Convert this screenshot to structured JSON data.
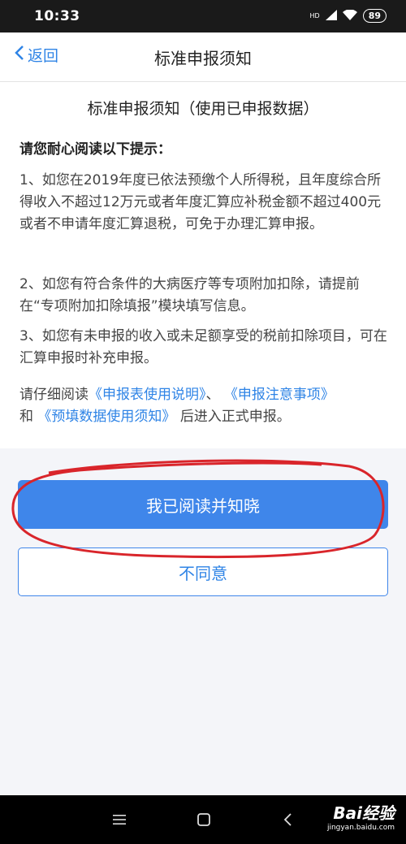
{
  "status_bar": {
    "time": "10:33",
    "battery": "89",
    "network": "HD"
  },
  "nav": {
    "back_label": "返回",
    "title": "标准申报须知"
  },
  "doc": {
    "title": "标准申报须知（使用已申报数据）",
    "prompt": "请您耐心阅读以下提示：",
    "items": [
      "1、如您在2019年度已依法预缴个人所得税，且年度综合所得收入不超过12万元或者年度汇算应补税金额不超过400元或者不申请年度汇算退税，可免于办理汇算申报。",
      "2、如您有符合条件的大病医疗等专项附加扣除，请提前在“专项附加扣除填报”模块填写信息。",
      "3、如您有未申报的收入或未足额享受的税前扣除项目，可在汇算申报时补充申报。"
    ],
    "footer": {
      "prefix": "请仔细阅读",
      "link1": "《申报表使用说明》",
      "sep": "、",
      "link2": "《申报注意事项》",
      "and": "和",
      "link3": "《预填数据使用须知》",
      "suffix": "后进入正式申报。"
    }
  },
  "buttons": {
    "agree": "我已阅读并知晓",
    "disagree": "不同意"
  },
  "colors": {
    "accent": "#3f86ea",
    "annotation": "#d9252b"
  },
  "watermark": {
    "brand": "Bai经验",
    "url": "jingyan.baidu.com"
  }
}
